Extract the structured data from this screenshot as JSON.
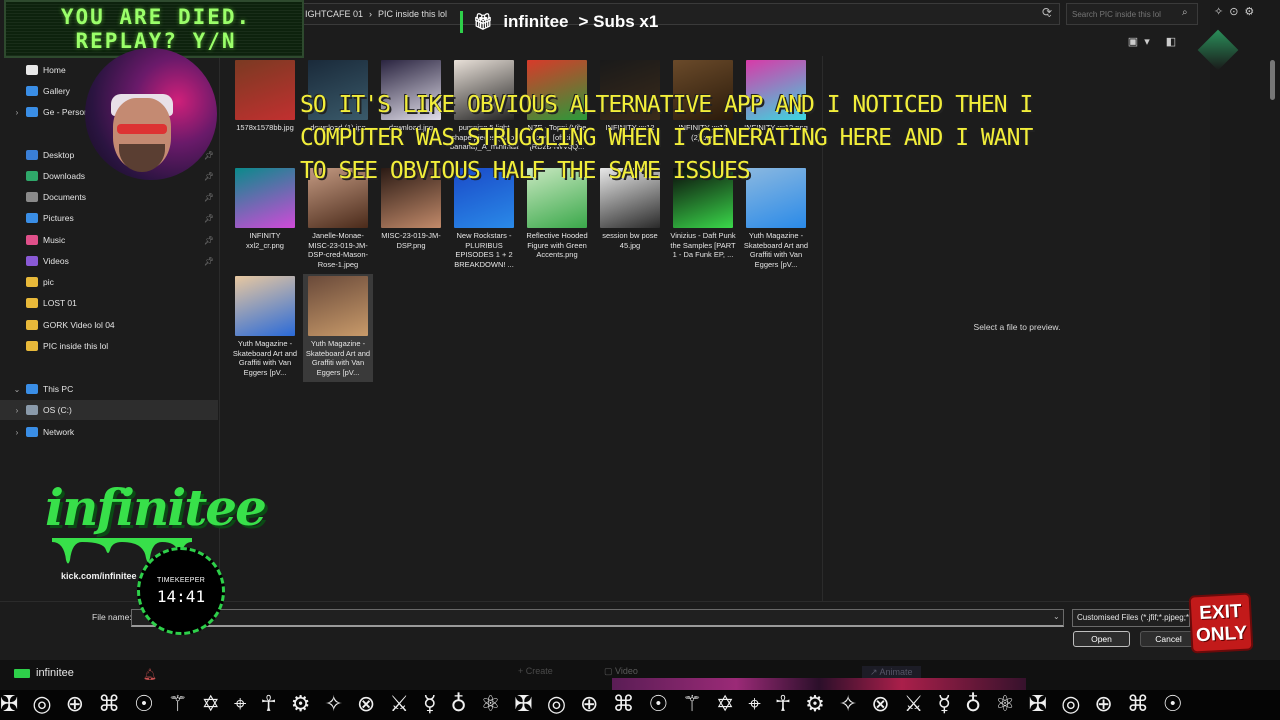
{
  "dialog": {
    "address": {
      "path_segment_1": "IGHTCAFE 01",
      "separator": "›",
      "path_segment_2": "PIC inside this lol"
    },
    "search": {
      "placeholder": "Search PIC inside this lol"
    },
    "preview_text": "Select a file to preview.",
    "file_name_label": "File name:",
    "file_name_value": "",
    "file_type": "Customised Files (*.jfif;*.pjpeg;*",
    "open_label": "Open",
    "cancel_label": "Cancel"
  },
  "nav": {
    "items": [
      {
        "label": "Home",
        "icon": "home-icon",
        "color": "#e8e8e8"
      },
      {
        "label": "Gallery",
        "icon": "gallery-icon",
        "color": "#3a8ee6"
      },
      {
        "label": "Ge - Person",
        "icon": "cloud-icon",
        "color": "#3a8ee6"
      },
      {
        "label": "Desktop",
        "icon": "desktop-icon",
        "color": "#3a7fd6"
      },
      {
        "label": "Downloads",
        "icon": "download-icon",
        "color": "#2fa86a"
      },
      {
        "label": "Documents",
        "icon": "document-icon",
        "color": "#8a8a8a"
      },
      {
        "label": "Pictures",
        "icon": "pictures-icon",
        "color": "#3a8ee6"
      },
      {
        "label": "Music",
        "icon": "music-icon",
        "color": "#e0508a"
      },
      {
        "label": "Videos",
        "icon": "videos-icon",
        "color": "#8a5ad6"
      },
      {
        "label": "pic",
        "icon": "folder-icon",
        "color": "#e8b93a"
      },
      {
        "label": "LOST 01",
        "icon": "folder-icon",
        "color": "#e8b93a"
      },
      {
        "label": "GORK Video lol 04",
        "icon": "folder-icon",
        "color": "#e8b93a"
      },
      {
        "label": "PIC inside this lol",
        "icon": "folder-icon",
        "color": "#e8b93a"
      },
      {
        "label": "This PC",
        "icon": "pc-icon",
        "color": "#3a8ee6"
      },
      {
        "label": "OS (C:)",
        "icon": "drive-icon",
        "color": "#8a9aaa"
      },
      {
        "label": "Network",
        "icon": "network-icon",
        "color": "#3a8ee6"
      }
    ]
  },
  "files": [
    {
      "name": "1578x1578bb.jpg",
      "c1": "#7a3a22",
      "c2": "#c23030"
    },
    {
      "name": "download (1).jpg",
      "c1": "#1a2a3a",
      "c2": "#3a5a6a"
    },
    {
      "name": "download.jpg",
      "c1": "#2a2440",
      "c2": "#e0dde8"
    },
    {
      "name": "pumping 5 light shape pieces (dino-banana)_A_minimalist_l...",
      "c1": "#e8e0d8",
      "c2": "#222222"
    },
    {
      "name": "NZE - Toppi (Vibe one) [official] [RDzB-NvVqQ...",
      "c1": "#d83a2a",
      "c2": "#2a9a3a"
    },
    {
      "name": "INFINITY xx12 (2).png",
      "c1": "#1a1a1a",
      "c2": "#3a2a1a"
    },
    {
      "name": "INFINITY xx12 (2).png",
      "c1": "#6a4a2a",
      "c2": "#2a1a0a"
    },
    {
      "name": "INFINITY xx12.png",
      "c1": "#d83aa8",
      "c2": "#3ad8e0"
    },
    {
      "name": "INFINITY xxl2_cr.png",
      "c1": "#0a8a8a",
      "c2": "#d04ad8"
    },
    {
      "name": "Janelle-Monae-MISC-23-019-JM-DSP-cred-Mason-Rose-1.jpeg",
      "c1": "#c49a82",
      "c2": "#4a2a1a"
    },
    {
      "name": "MISC-23-019-JM-DSP.png",
      "c1": "#2a1a14",
      "c2": "#c28a6a"
    },
    {
      "name": "New Rockstars - PLURIBUS EPISODES 1 + 2 BREAKDOWN! ...",
      "c1": "#1a4ac8",
      "c2": "#2a8ae8"
    },
    {
      "name": "Reflective Hooded Figure with Green Accents.png",
      "c1": "#c8e8c0",
      "c2": "#3aa84a"
    },
    {
      "name": "session bw pose 45.jpg",
      "c1": "#e8e8e8",
      "c2": "#2a2a2a"
    },
    {
      "name": "Vinizius - Daft Punk the Samples [PART 1 - Da Funk EP, ...",
      "c1": "#0a0a0a",
      "c2": "#3ad84a"
    },
    {
      "name": "Yuth Magazine - Skateboard Art and Graffiti with Van Eggers [pV...",
      "c1": "#8ab8e0",
      "c2": "#2a8ae8"
    },
    {
      "name": "Yuth Magazine - Skateboard Art and Graffiti with Van Eggers [pV...",
      "c1": "#e8c8a0",
      "c2": "#2a6ad8"
    },
    {
      "name": "Yuth Magazine - Skateboard Art and Graffiti with Van Eggers [pV...",
      "c1": "#6a4a3a",
      "c2": "#c89a6a"
    }
  ],
  "app": {
    "brand": "infinitee",
    "create": "+ Create",
    "video": "▢ Video",
    "animate": "↗ Animate"
  },
  "overlay": {
    "died_line1": "YOU ARE DIED.",
    "died_line2": "REPLAY? Y/N",
    "top_logo_name": "infinitee",
    "top_logo_sub": "> Subs x1",
    "caption": "SO IT'S LIKE OBVIOUS ALTERNATIVE APP AND I NOTICED THEN I COMPUTER WAS STRUGGLING WHEN I GENERATING HERE AND I WANT TO SEE OBVIOUS HALF THE SAME ISSUES",
    "logo_text": "infinitee",
    "kick_url": "kick.com/infinitee",
    "timekeeper_label": "TIMEKEEPER",
    "timekeeper_time": "14:41",
    "exit_line1": "EXIT",
    "exit_line2": "ONLY"
  },
  "colors": {
    "accent": "#2ed04a",
    "caption": "#f2ee3a",
    "exit": "#c21a1a"
  }
}
